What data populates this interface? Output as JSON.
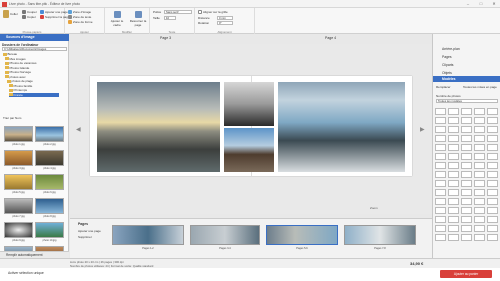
{
  "window": {
    "title": "Livre photo - Sans titre.pbk - Éditeur de livre photo",
    "controls": [
      "–",
      "□",
      "✕"
    ]
  },
  "ribbon": {
    "groups": [
      {
        "label": "Presse-papiers",
        "items": [
          "Coller",
          "Couper",
          "Copier",
          "Ajouter une page",
          "Supprimer la page"
        ]
      },
      {
        "label": "Ajouter",
        "items": [
          "Zone d'image",
          "Zone de texte",
          "Zone de forme"
        ]
      },
      {
        "label": "Modifier",
        "items": [
          "Ajuster le cadre",
          "Retourner la page"
        ]
      },
      {
        "label": "Texte",
        "items": [
          "Police",
          "Taille"
        ]
      },
      {
        "label": "Alignement",
        "items": [
          "Aligner sur la grille",
          "Distance",
          "Rotation"
        ]
      }
    ],
    "fields": {
      "font": "Sans serif",
      "size": "10",
      "distance": "0 mm",
      "rotation": "0°"
    }
  },
  "left_panel": {
    "header": "Sources d'image",
    "section": "Dossiers de l'ordinateur",
    "path": "C:\\Utilisateurs\\Documents\\Images",
    "tree": [
      "Bureau",
      "Mes images",
      "Photos de vacances",
      "Photos Islande",
      "Photos Norvège",
      "photos avec",
      "photos de plage",
      "Photos famille",
      "Printemps",
      "France"
    ],
    "sort_label": "Trier par Nom",
    "thumbs": [
      {
        "label": "photo 1.jpg"
      },
      {
        "label": "photo 2.jpg"
      },
      {
        "label": "photo 3.jpg"
      },
      {
        "label": "photo 4.jpg"
      },
      {
        "label": "photo 5.jpg"
      },
      {
        "label": "photo 6.jpg"
      },
      {
        "label": "photo 7.jpg"
      },
      {
        "label": "photo 8.jpg"
      },
      {
        "label": "photo 9.jpg"
      },
      {
        "label": "photo 10.jpg"
      },
      {
        "label": "photo 11.jpg"
      },
      {
        "label": "photo 12.jpg"
      }
    ],
    "autofill": "Remplir automatiquement"
  },
  "canvas": {
    "page_left": "Page 3",
    "page_right": "Page 4",
    "zoom": "Zoom"
  },
  "right_panel": {
    "items": [
      "Arrière-plan",
      "Pages",
      "Cliparts",
      "Objets",
      "Modèles"
    ],
    "active": "Modèles",
    "sub": [
      "Remplacer",
      "Toutes les mises en page"
    ],
    "select": "Toutes les modèles",
    "count_label": "Nombre de photos"
  },
  "filmstrip": {
    "title": "Pages",
    "buttons": [
      "Ajouter une page",
      "Supprimer"
    ],
    "labels": [
      "Pages 1-2",
      "Pages 3-4",
      "Pages 5-6",
      "Pages 7-8"
    ]
  },
  "status": {
    "line1": "Livre photo 20 x 20 cm | 26 pages | 300 dpi",
    "line2": "Nombre de photos utilisées: 24 | Format de sortie: Qualité standard",
    "price": "34,90 €"
  },
  "bottom": {
    "left_button": "Activer sélection unique",
    "order_button": "Ajouter au panier"
  }
}
